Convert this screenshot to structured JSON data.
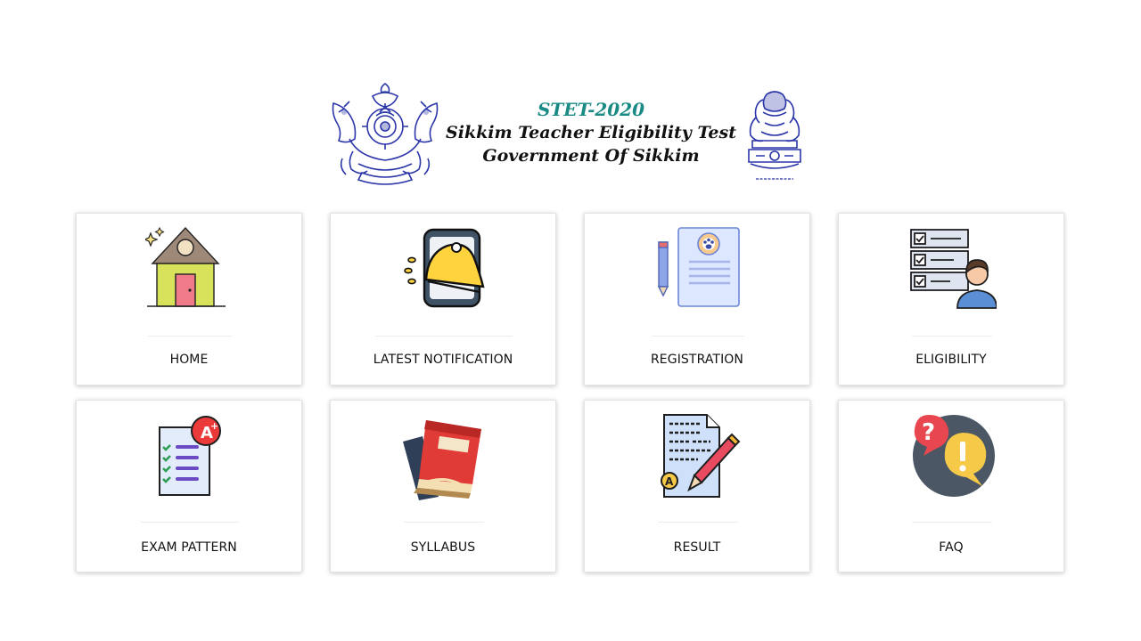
{
  "header": {
    "title_line1": "STET-2020",
    "title_line2": "Sikkim Teacher Eligibility Test",
    "title_line3": "Government Of Sikkim",
    "left_emblem": "sikkim-state-emblem",
    "right_emblem": "national-emblem-of-india",
    "accent_color": "#1a8a85"
  },
  "cards": [
    {
      "label": "HOME",
      "icon": "house-icon"
    },
    {
      "label": "LATEST NOTIFICATION",
      "icon": "phone-bell-icon"
    },
    {
      "label": "REGISTRATION",
      "icon": "form-pencil-icon"
    },
    {
      "label": "ELIGIBILITY",
      "icon": "checklist-person-icon"
    },
    {
      "label": "EXAM PATTERN",
      "icon": "graded-checklist-icon"
    },
    {
      "label": "SYLLABUS",
      "icon": "books-icon"
    },
    {
      "label": "RESULT",
      "icon": "result-sheet-pen-icon"
    },
    {
      "label": "FAQ",
      "icon": "question-exclamation-icon"
    }
  ]
}
